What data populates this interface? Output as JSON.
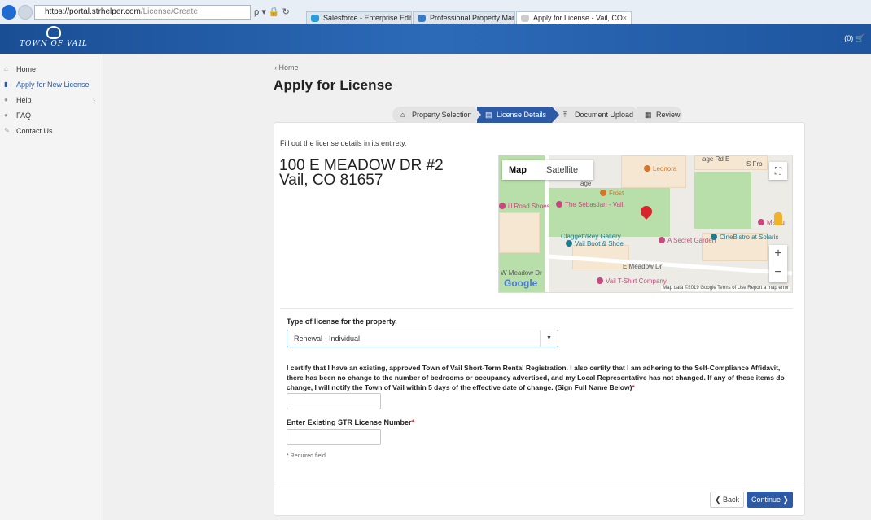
{
  "browser": {
    "url_host": "https://portal.strhelper.com",
    "url_path": "/License/Create",
    "addr_icons": "ρ ▾ 🔒 ↻",
    "tabs": [
      {
        "label": "Salesforce - Enterprise Edition"
      },
      {
        "label": "Professional Property Manager..."
      },
      {
        "label": "Apply for License - Vail, CO"
      }
    ],
    "tab_close": "×"
  },
  "header": {
    "logo_text": "TOWN OF VAIL",
    "cart_text": "(0) 🛒"
  },
  "sidebar": {
    "items": [
      {
        "label": "Home",
        "icon": "⌂"
      },
      {
        "label": "Apply for New License",
        "icon": "▮"
      },
      {
        "label": "Help",
        "icon": "●",
        "chevron": "›"
      },
      {
        "label": "FAQ",
        "icon": "●"
      },
      {
        "label": "Contact Us",
        "icon": "✎"
      }
    ]
  },
  "breadcrumb": "‹ Home",
  "page_title": "Apply for License",
  "steps": [
    {
      "label": "Property Selection",
      "icon": "⌂"
    },
    {
      "label": "License Details",
      "icon": "▤"
    },
    {
      "label": "Document Upload",
      "icon": "⤒"
    },
    {
      "label": "Review",
      "icon": "▦"
    }
  ],
  "form": {
    "intro": "Fill out the license details in its entirety.",
    "address_line1": "100 E MEADOW DR #2",
    "address_line2": "Vail, CO 81657",
    "license_type_label": "Type of license for the property.",
    "license_type_value": "Renewal - Individual",
    "select_caret": "▼",
    "certify_text": "I certify that I have an existing, approved Town of Vail Short-Term Rental Registration. I also certify that I am adhering to the Self-Compliance Affidavit, there has been no change to the number of bedrooms or occupancy advertised, and my Local Representative has not changed. If any of these items do change, I will notify the Town of Vail within 5 days of the effective date of change. (Sign Full Name Below)",
    "required_mark": "*",
    "signature_value": "",
    "license_number_label": "Enter Existing STR License Number",
    "license_number_value": "",
    "required_note": "* Required field"
  },
  "map": {
    "type_map": "Map",
    "type_satellite": "Satellite",
    "fullscreen": "⛶",
    "zoom_in": "+",
    "zoom_out": "−",
    "google": "Google",
    "footer": "Map data ©2019 Google   Terms of Use   Report a map error",
    "labels": [
      {
        "text": "Leonora"
      },
      {
        "text": "Frost"
      },
      {
        "text": "The Sebastian - Vail"
      },
      {
        "text": "Claggett/Rey Gallery"
      },
      {
        "text": "Vail Boot & Shoe"
      },
      {
        "text": "A Secret Garden"
      },
      {
        "text": "CineBistro at Solaris"
      },
      {
        "text": "E Meadow Dr"
      },
      {
        "text": "Vail T-Shirt Company"
      },
      {
        "text": "Matsu"
      },
      {
        "text": "S Fro"
      },
      {
        "text": "age Rd E"
      },
      {
        "text": "ill Road Shoes"
      },
      {
        "text": "age"
      },
      {
        "text": "W Meadow Dr"
      }
    ]
  },
  "buttons": {
    "back": "❮ Back",
    "continue": "Continue ❯"
  },
  "colors": {
    "header_blue": "#2c6ab8",
    "primary": "#2c5aa6",
    "required": "#c9302c",
    "map_pin": "#d7262b"
  }
}
